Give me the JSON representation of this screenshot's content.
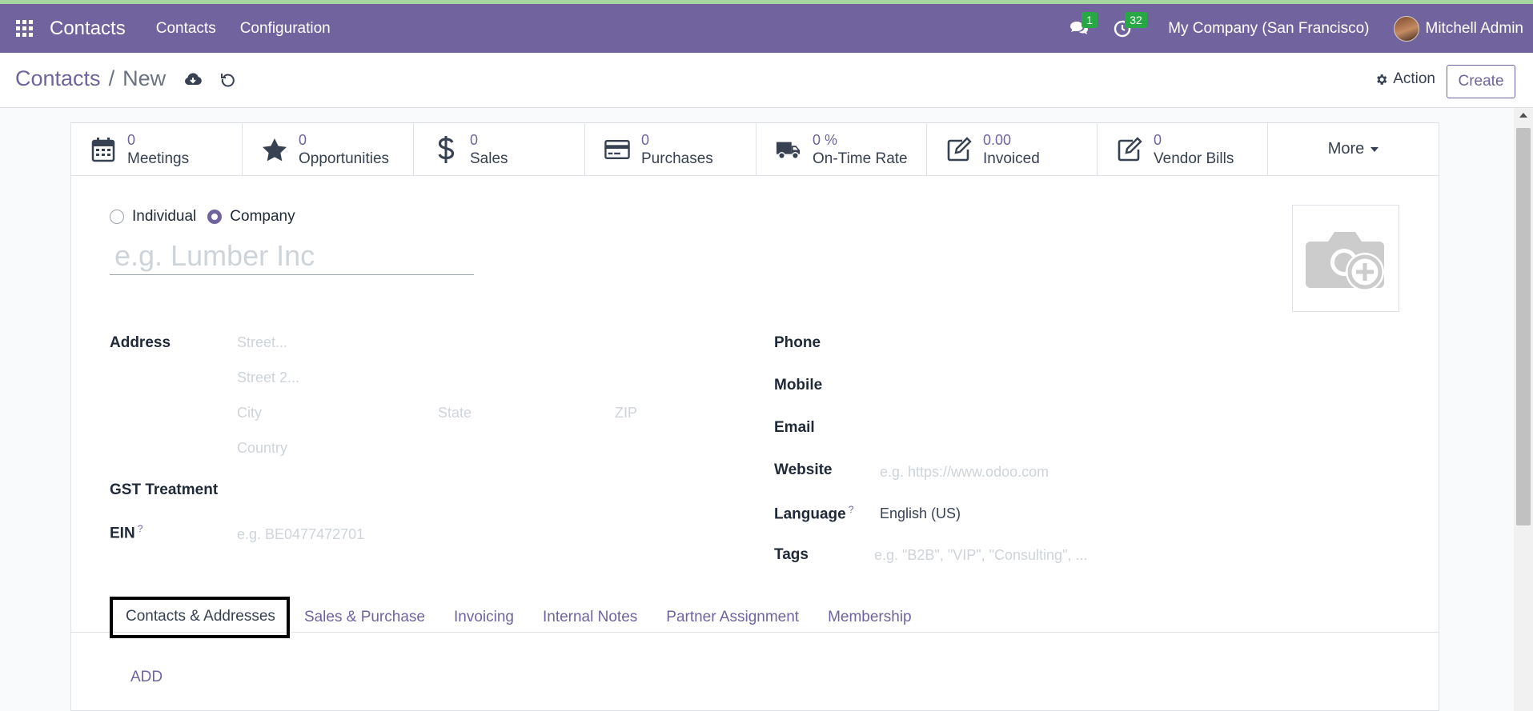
{
  "navbar": {
    "brand": "Contacts",
    "menu": [
      "Contacts",
      "Configuration"
    ],
    "messages_count": "1",
    "activities_count": "32",
    "company": "My Company (San Francisco)",
    "user": "Mitchell Admin",
    "bg_color": "#71639e"
  },
  "control": {
    "breadcrumb_parent": "Contacts",
    "breadcrumb_sep": "/",
    "breadcrumb_current": "New",
    "action_label": "Action",
    "create_label": "Create"
  },
  "stats": [
    {
      "value": "0",
      "label": "Meetings",
      "icon": "calendar-icon"
    },
    {
      "value": "0",
      "label": "Opportunities",
      "icon": "star-icon"
    },
    {
      "value": "0",
      "label": "Sales",
      "icon": "dollar-icon"
    },
    {
      "value": "0",
      "label": "Purchases",
      "icon": "credit-card-icon"
    },
    {
      "value": "0 %",
      "label": "On-Time Rate",
      "icon": "truck-icon"
    },
    {
      "value": "0.00",
      "label": "Invoiced",
      "icon": "edit-icon"
    },
    {
      "value": "0",
      "label": "Vendor Bills",
      "icon": "edit-icon"
    }
  ],
  "more_label": "More",
  "company_type": {
    "options": [
      "Individual",
      "Company"
    ],
    "selected": "Company"
  },
  "name_placeholder": "e.g. Lumber Inc",
  "left_fields": {
    "address_label": "Address",
    "street_ph": "Street...",
    "street2_ph": "Street 2...",
    "city_ph": "City",
    "state_ph": "State",
    "zip_ph": "ZIP",
    "country_ph": "Country",
    "gst_label": "GST Treatment",
    "ein_label": "EIN",
    "ein_help": "?",
    "ein_ph": "e.g. BE0477472701"
  },
  "right_fields": {
    "phone_label": "Phone",
    "mobile_label": "Mobile",
    "email_label": "Email",
    "website_label": "Website",
    "website_ph": "e.g. https://www.odoo.com",
    "language_label": "Language",
    "language_help": "?",
    "language_value": "English (US)",
    "tags_label": "Tags",
    "tags_ph": "e.g. \"B2B\", \"VIP\", \"Consulting\", ..."
  },
  "tabs": [
    "Contacts & Addresses",
    "Sales & Purchase",
    "Invoicing",
    "Internal Notes",
    "Partner Assignment",
    "Membership"
  ],
  "active_tab": "Contacts & Addresses",
  "add_label": "ADD"
}
